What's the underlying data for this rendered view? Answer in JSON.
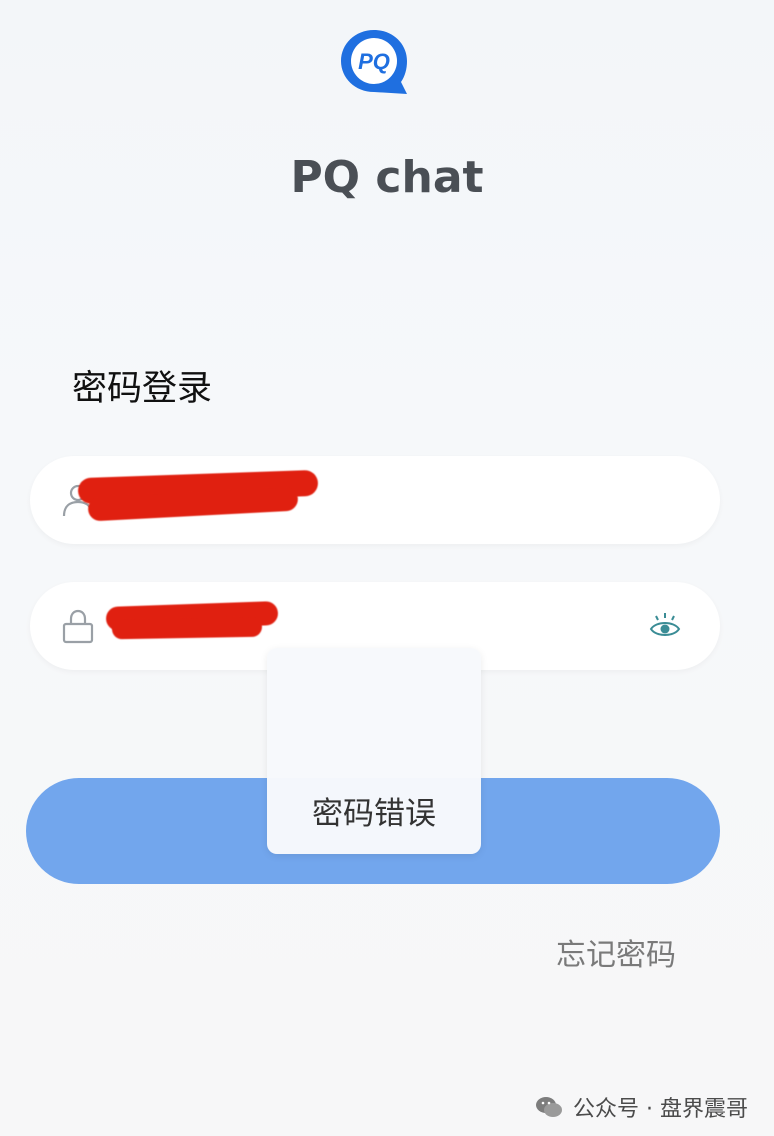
{
  "app": {
    "logo_text": "PQ",
    "title": "PQ chat",
    "brand_color": "#1f6fe0"
  },
  "login": {
    "section_title": "密码登录",
    "username_icon": "user-icon",
    "password_icon": "lock-icon",
    "show_password_icon": "eye-icon",
    "login_button_color": "#72a6ed",
    "forgot_password": "忘记密码"
  },
  "toast": {
    "message": "密码错误"
  },
  "watermark": {
    "icon": "wechat-icon",
    "text": "公众号 · 盘界震哥"
  },
  "colors": {
    "redaction": "#e02010",
    "icon_teal": "#3a8c95"
  }
}
